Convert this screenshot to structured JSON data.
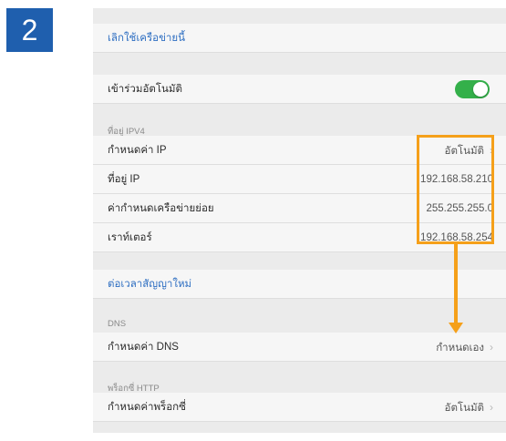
{
  "step": {
    "number": "2"
  },
  "settings": {
    "forget_network": {
      "label": "เลิกใช้เครือข่ายนี้"
    },
    "auto_join": {
      "label": "เข้าร่วมอัตโนมัติ",
      "enabled": true
    },
    "ipv4_section": {
      "header": "ที่อยู่ IPV4"
    },
    "configure_ip": {
      "label": "กำหนดค่า IP",
      "value": "อัตโนมัติ"
    },
    "ip_address": {
      "label": "ที่อยู่ IP",
      "value": "192.168.58.210"
    },
    "subnet_mask": {
      "label": "ค่ากำหนดเครือข่ายย่อย",
      "value": "255.255.255.0"
    },
    "router": {
      "label": "เราท์เตอร์",
      "value": "192.168.58.254"
    },
    "renew_lease": {
      "label": "ต่อเวลาสัญญาใหม่"
    },
    "dns_section": {
      "header": "DNS"
    },
    "configure_dns": {
      "label": "กำหนดค่า DNS",
      "value": "กำหนดเอง"
    },
    "proxy_section": {
      "header": "พร็อกซี่ HTTP"
    },
    "configure_proxy": {
      "label": "กำหนดค่าพร็อกซี่",
      "value": "อัตโนมัติ"
    }
  },
  "colors": {
    "badge": "#1f5fae",
    "link": "#2f6fc2",
    "toggle_on": "#34b04a",
    "highlight": "#f5a01a"
  },
  "icons": {
    "chevron": "›"
  }
}
